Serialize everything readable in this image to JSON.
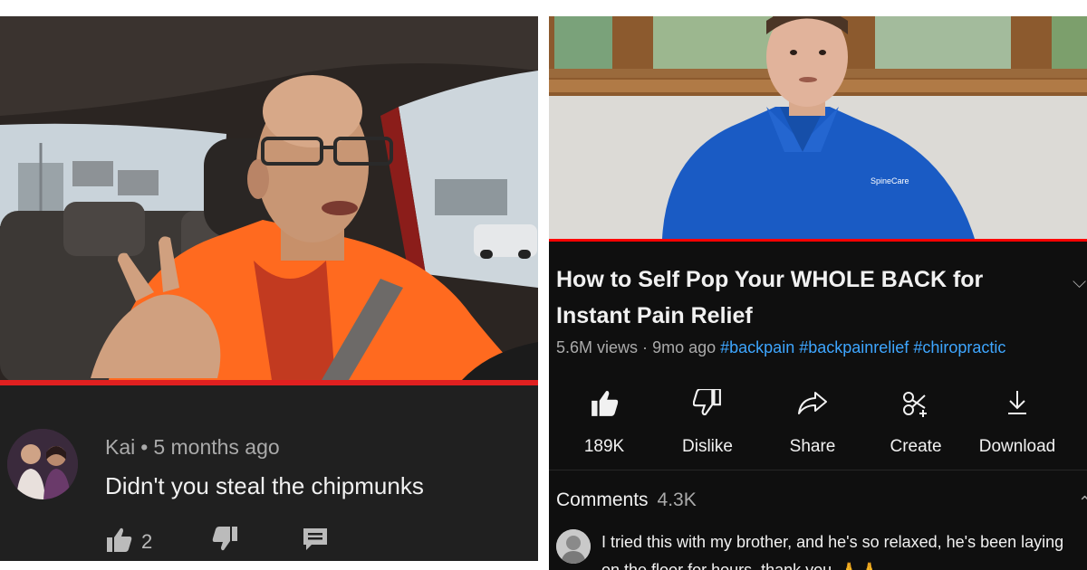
{
  "left_comment": {
    "author": "Kai",
    "separator": "•",
    "time": "5 months ago",
    "text": "Didn't you steal the chipmunks",
    "like_count": "2",
    "icons": [
      "thumbs-up-icon",
      "thumbs-down-icon",
      "reply-icon"
    ]
  },
  "right_video": {
    "title": "How to Self Pop Your WHOLE BACK for Instant Pain Relief",
    "views": "5.6M views",
    "separator": "·",
    "age": "9mo ago",
    "hashtags": [
      "#backpain",
      "#backpainrelief",
      "#chiropractic"
    ],
    "shirt_logo": "SpineCare",
    "actions": {
      "like": "189K",
      "dislike": "Dislike",
      "share": "Share",
      "create": "Create",
      "download": "Download"
    },
    "comments": {
      "label": "Comments",
      "count": "4.3K",
      "top_comment": "I tried this with my brother, and he's so relaxed, he's been laying on the floor for hours, thank you",
      "emoji": "🙏🙏"
    }
  },
  "colors": {
    "progress_red": "#ff0000",
    "hashtag_blue": "#3ea6ff",
    "background_dark": "#0f0f0f",
    "comment_bg": "#202020"
  }
}
